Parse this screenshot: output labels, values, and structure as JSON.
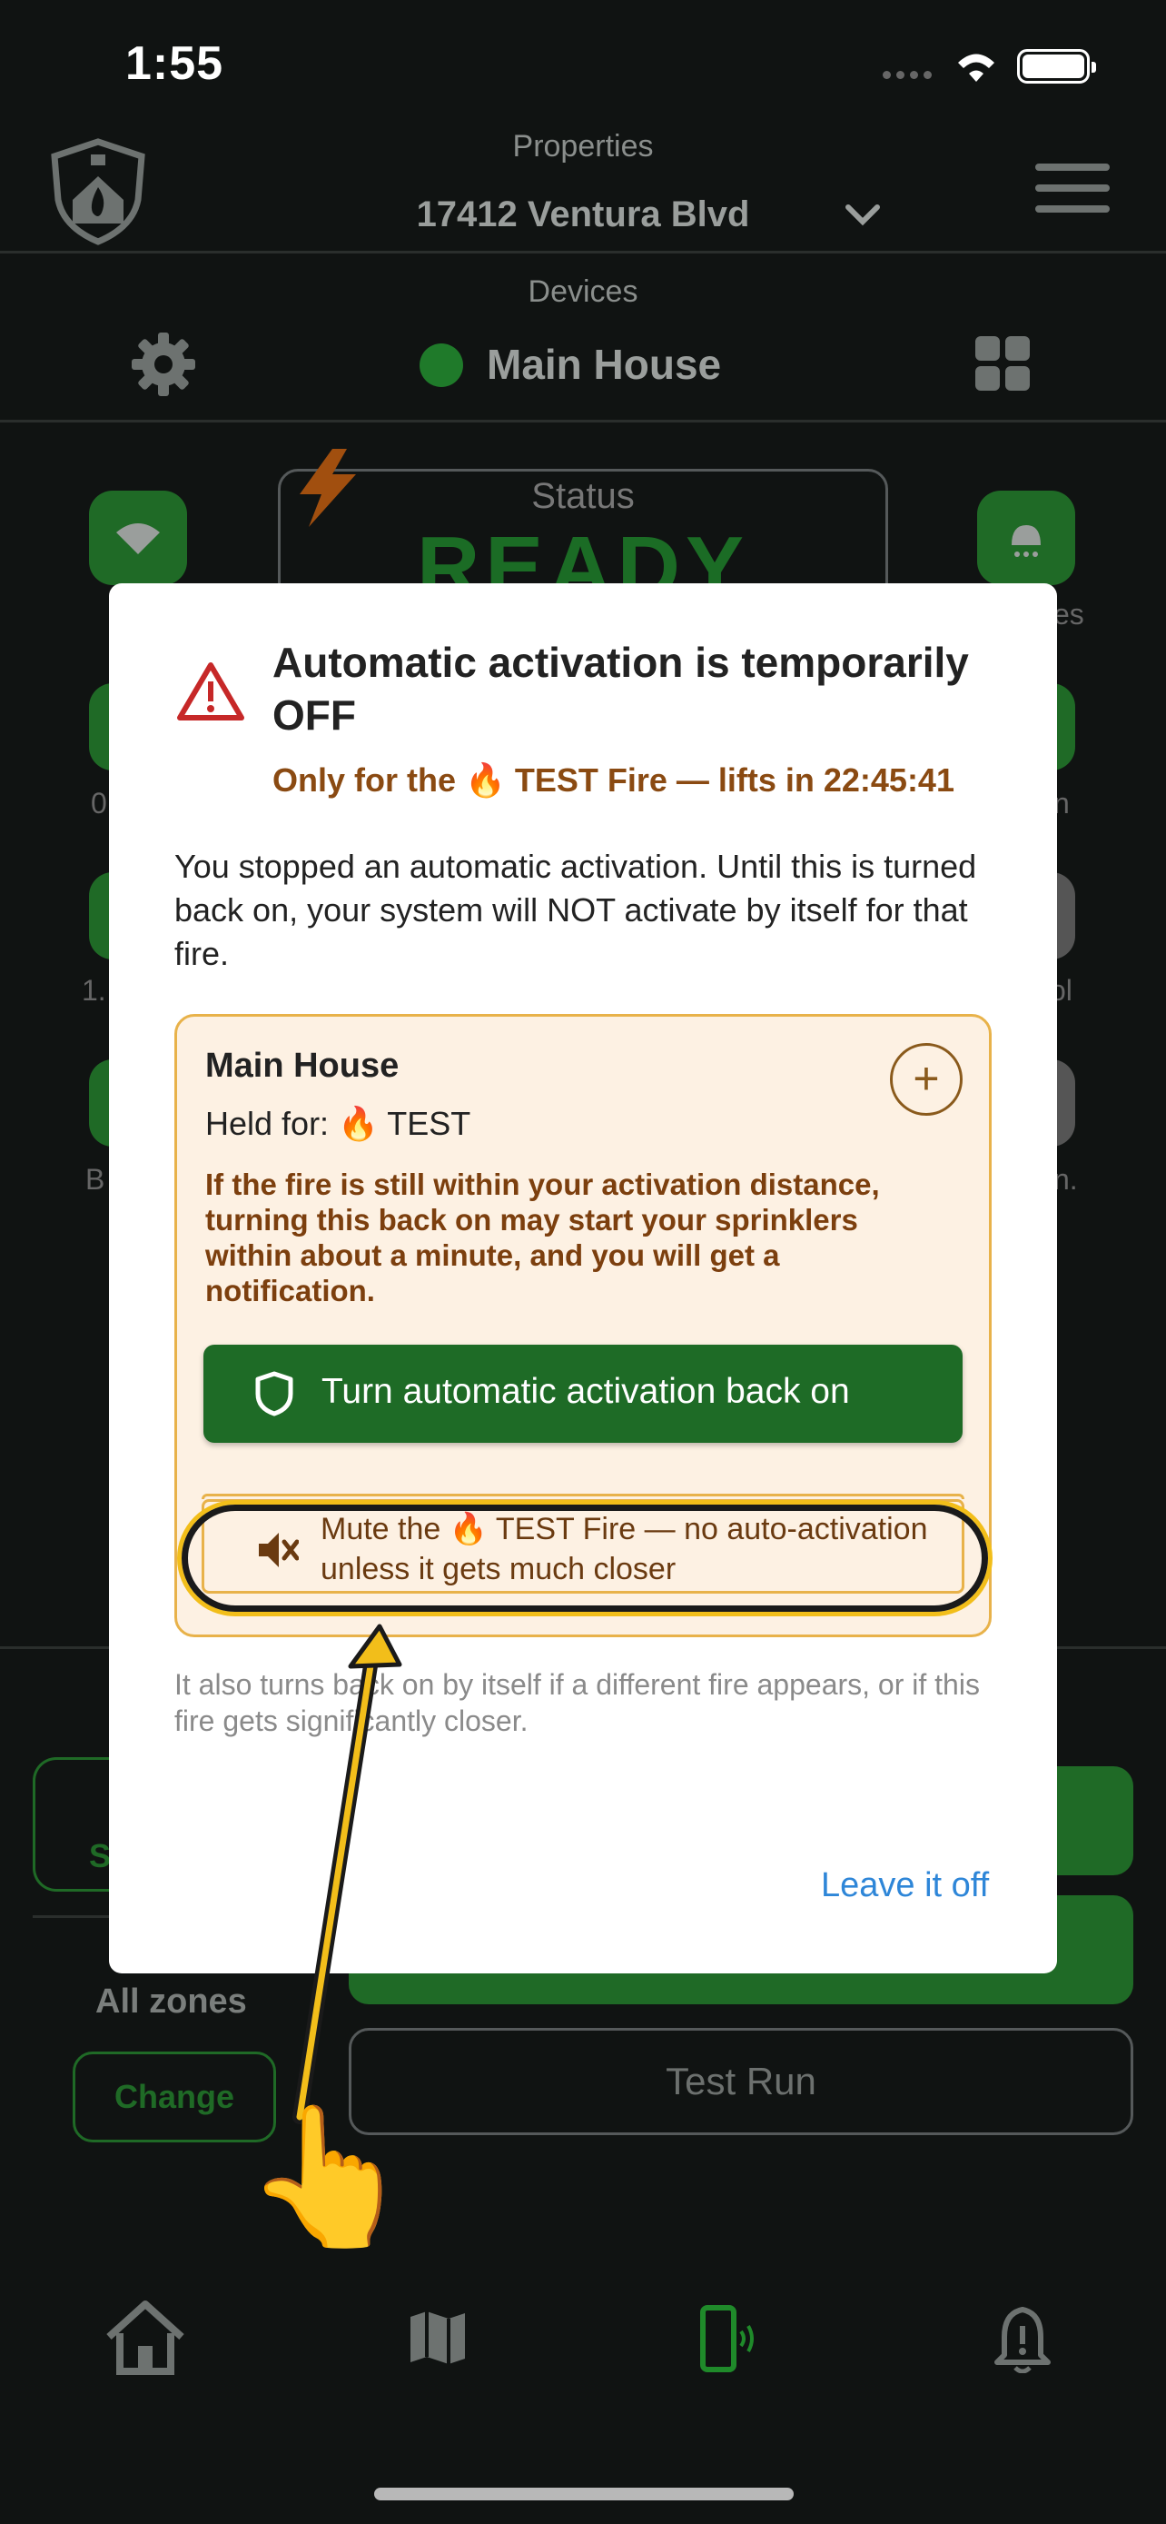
{
  "status_bar": {
    "time": "1:55"
  },
  "header": {
    "properties_label": "Properties",
    "property_name": "17412 Ventura Blvd",
    "devices_label": "Devices",
    "device_name": "Main House"
  },
  "dashboard": {
    "status_label": "Status",
    "status_value": "READY",
    "frag_es": "es",
    "frag_0": "0",
    "frag_n": "n",
    "frag_1": "1.",
    "frag_ol": "ol",
    "frag_b": "B",
    "frag_n2": "n.",
    "frag_s": "S",
    "all_zones": "All zones",
    "change": "Change",
    "test_run": "Test Run"
  },
  "modal": {
    "title": "Automatic activation is temporarily OFF",
    "subtitle": "Only for the 🔥 TEST Fire — lifts in 22:45:41",
    "body": "You stopped an automatic activation. Until this is turned back on, your system will NOT activate by itself for that fire.",
    "card": {
      "title": "Main House",
      "held": "Held for: 🔥  TEST",
      "warning": "If the fire is still within your activation distance, turning this back on may start your sprinklers within about a minute, and you will get a notification.",
      "primary_button": "Turn automatic activation back on",
      "mute_button": "Mute the 🔥  TEST Fire — no auto-activation unless it gets much closer"
    },
    "footnote": "It also turns back on by itself if a different fire appears, or if this fire gets significantly closer.",
    "leave_button": "Leave it off"
  },
  "colors": {
    "background": "#101312",
    "accent_green": "#1e6b26",
    "warning_brown": "#7c3f0e",
    "card_bg": "#fdf1e3",
    "card_border": "#e8b24a",
    "link_blue": "#2e86d8",
    "highlight_yellow": "#f2be1a"
  },
  "icons": [
    "shield-logo-icon",
    "chevron-down-icon",
    "menu-icon",
    "gear-icon",
    "grid-icon",
    "wifi-icon",
    "sprinkler-icon",
    "warning-triangle-icon",
    "plus-icon",
    "shield-outline-icon",
    "speaker-mute-icon",
    "home-icon",
    "map-icon",
    "device-icon",
    "bell-icon",
    "pointing-hand-icon"
  ]
}
